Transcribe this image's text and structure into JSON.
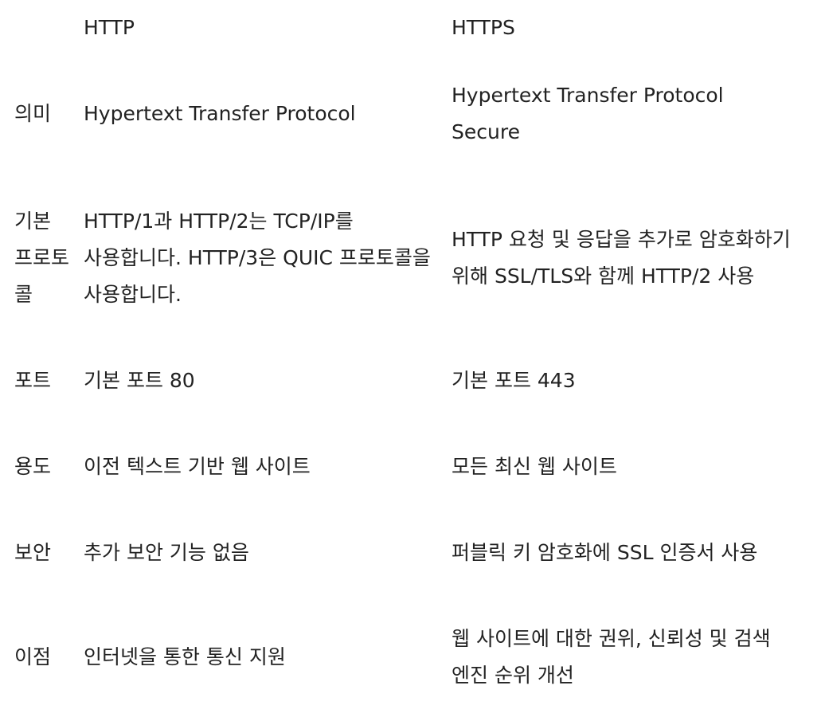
{
  "table": {
    "headers": [
      "",
      "HTTP",
      "HTTPS"
    ],
    "rows": [
      {
        "label": "의미",
        "http": "Hypertext Transfer Protocol",
        "https": "Hypertext Transfer Protocol Secure"
      },
      {
        "label": "기본 프로토콜",
        "http": "HTTP/1과 HTTP/2는 TCP/IP를 사용합니다. HTTP/3은 QUIC 프로토콜을 사용합니다.",
        "https": "HTTP 요청 및 응답을 추가로 암호화하기 위해 SSL/TLS와 함께 HTTP/2 사용"
      },
      {
        "label": "포트",
        "http": "기본 포트 80",
        "https": "기본 포트 443"
      },
      {
        "label": "용도",
        "http": "이전 텍스트 기반 웹 사이트",
        "https": "모든 최신 웹 사이트"
      },
      {
        "label": "보안",
        "http": "추가 보안 기능 없음",
        "https": "퍼블릭 키 암호화에 SSL 인증서 사용"
      },
      {
        "label": "이점",
        "http": "인터넷을 통한 통신 지원",
        "https": "웹 사이트에 대한 권위, 신뢰성 및 검색 엔진 순위 개선"
      }
    ]
  }
}
